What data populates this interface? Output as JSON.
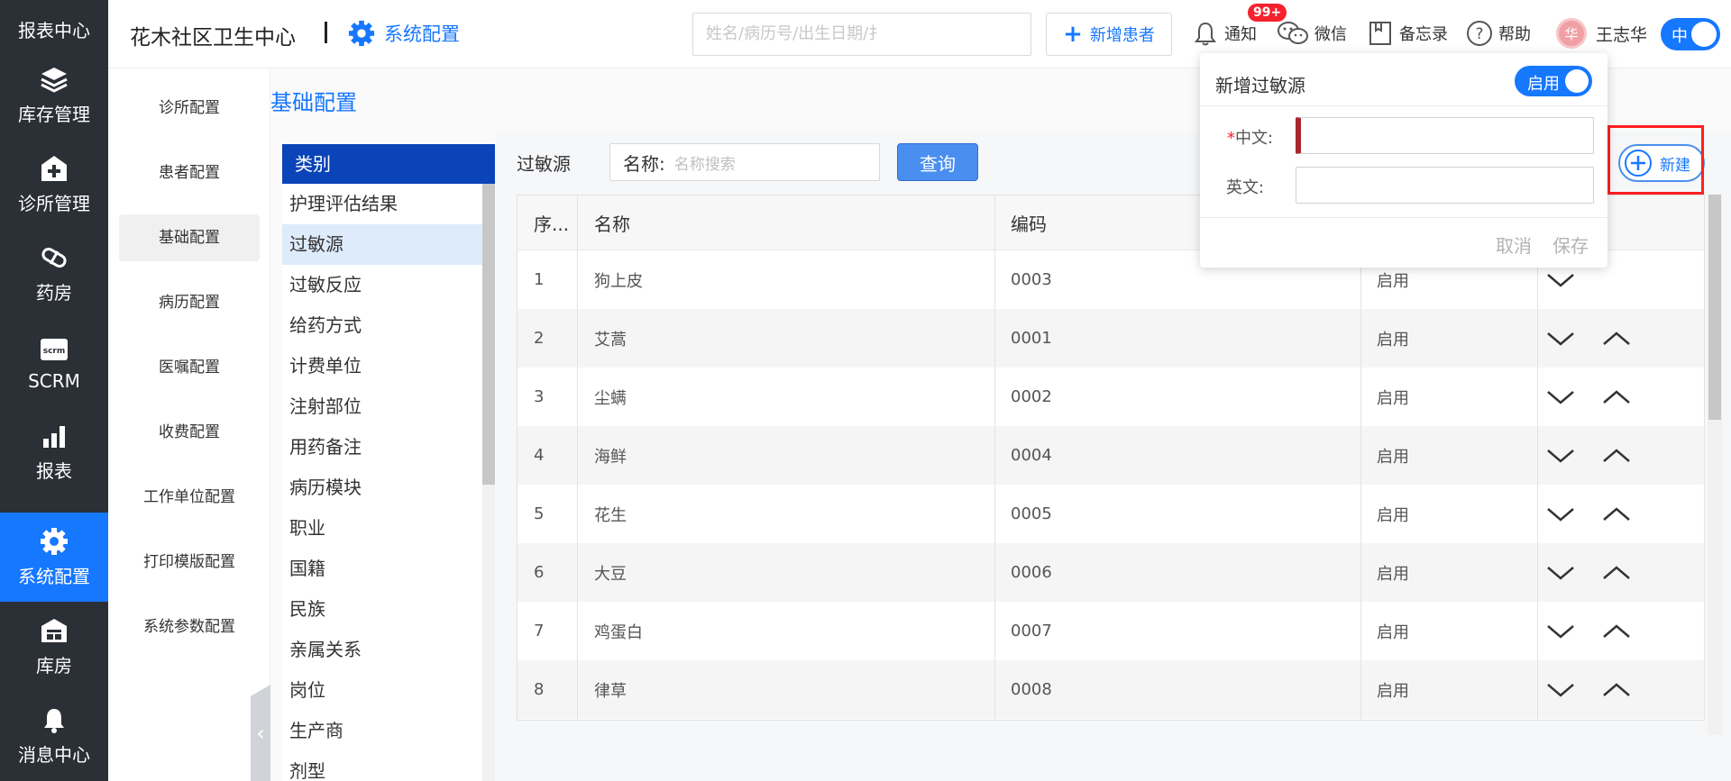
{
  "leftnav": {
    "items": [
      {
        "label": "报表中心",
        "icon": "report-center-icon"
      },
      {
        "label": "库存管理",
        "icon": "layers-icon"
      },
      {
        "label": "诊所管理",
        "icon": "hospital-plus-icon"
      },
      {
        "label": "药房",
        "icon": "pill-icon"
      },
      {
        "label": "SCRM",
        "icon": "scrm-icon"
      },
      {
        "label": "报表",
        "icon": "bar-chart-icon"
      },
      {
        "label": "系统配置",
        "icon": "gear-icon"
      },
      {
        "label": "库房",
        "icon": "warehouse-icon"
      },
      {
        "label": "消息中心",
        "icon": "bell-icon"
      }
    ]
  },
  "header": {
    "clinic_name": "花木社区卫生中心",
    "section": "系统配置",
    "search_placeholder": "姓名/病历号/出生日期/扌",
    "new_patient": "新增患者",
    "notify": "通知",
    "notify_badge": "99+",
    "wechat": "微信",
    "memo": "备忘录",
    "help": "帮助",
    "avatar_char": "华",
    "username": "王志华",
    "lang": "中"
  },
  "subnav": {
    "items": [
      "诊所配置",
      "患者配置",
      "基础配置",
      "病历配置",
      "医嘱配置",
      "收费配置",
      "工作单位配置",
      "打印模版配置",
      "系统参数配置"
    ]
  },
  "page": {
    "title": "基础配置"
  },
  "categories": {
    "header": "类别",
    "items": [
      "护理评估结果",
      "过敏源",
      "过敏反应",
      "给药方式",
      "计费单位",
      "注射部位",
      "用药备注",
      "病历模块",
      "职业",
      "国籍",
      "民族",
      "亲属关系",
      "岗位",
      "生产商",
      "剂型"
    ],
    "selected": "过敏源"
  },
  "filter": {
    "label": "过敏源",
    "name_label": "名称:",
    "name_placeholder": "名称搜索",
    "query_button": "查询",
    "new_button": "新建"
  },
  "table": {
    "columns": [
      "序...",
      "名称",
      "编码",
      "",
      ""
    ],
    "rows": [
      {
        "no": "1",
        "name": "狗上皮",
        "code": "0003",
        "status": "启用"
      },
      {
        "no": "2",
        "name": "艾蒿",
        "code": "0001",
        "status": "启用"
      },
      {
        "no": "3",
        "name": "尘螨",
        "code": "0002",
        "status": "启用"
      },
      {
        "no": "4",
        "name": "海鲜",
        "code": "0004",
        "status": "启用"
      },
      {
        "no": "5",
        "name": "花生",
        "code": "0005",
        "status": "启用"
      },
      {
        "no": "6",
        "name": "大豆",
        "code": "0006",
        "status": "启用"
      },
      {
        "no": "7",
        "name": "鸡蛋白",
        "code": "0007",
        "status": "启用"
      },
      {
        "no": "8",
        "name": "律草",
        "code": "0008",
        "status": "启用"
      }
    ]
  },
  "popover": {
    "title": "新增过敏源",
    "toggle_label": "启用",
    "required_mark": "*",
    "cn_label": "中文:",
    "en_label": "英文:",
    "cn_value": "",
    "en_value": "",
    "cancel": "取消",
    "save": "保存"
  },
  "colors": {
    "accent": "#1677ff",
    "nav_bg": "#2b2f36",
    "category_header": "#0a44b8",
    "highlight": "#ff1f1f"
  }
}
